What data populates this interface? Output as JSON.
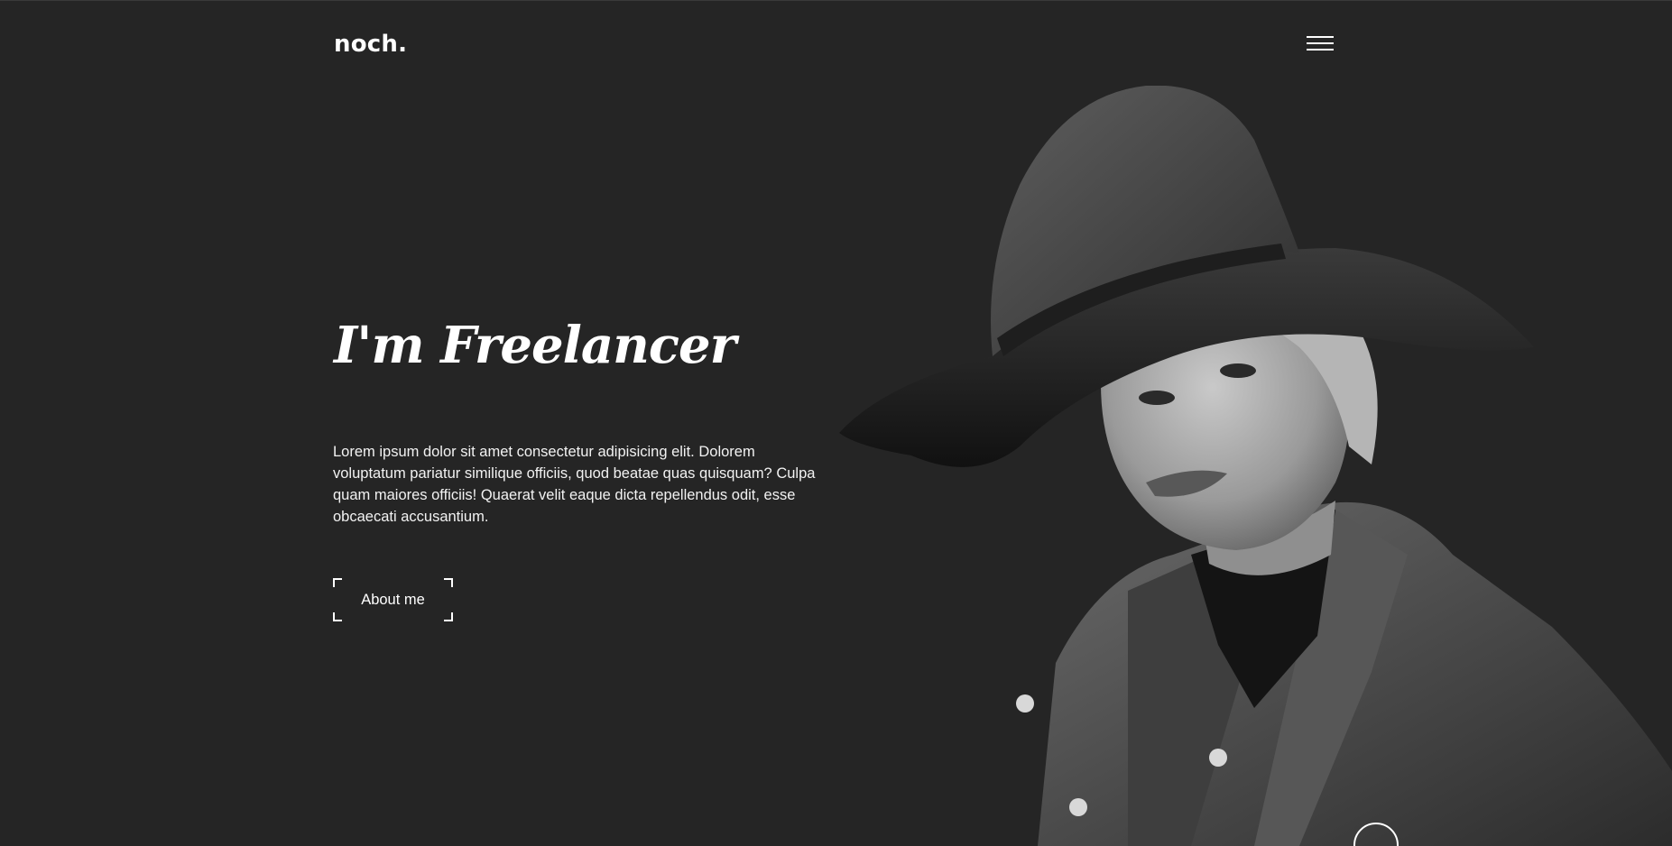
{
  "header": {
    "logo": "noch.",
    "menu_icon": "hamburger-menu-icon"
  },
  "hero": {
    "title": "I'm Freelancer",
    "description": "Lorem ipsum dolor sit amet consectetur adipisicing elit. Dolorem voluptatum pariatur similique officiis, quod beatae quas quisquam? Culpa quam maiores officiis! Quaerat velit eaque dicta repellendus odit, esse obcaecati accusantium.",
    "cta_label": "About me",
    "image_subject": "black-and-white portrait of woman in wide-brim hat and leather jacket"
  },
  "colors": {
    "background": "#252525",
    "text": "#ffffff"
  }
}
